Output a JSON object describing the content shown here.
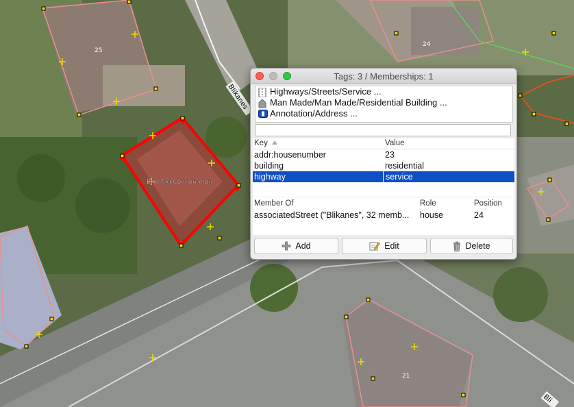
{
  "map": {
    "street_name_left": "Blikanes",
    "street_name_right": "Bli",
    "house_numbers": [
      "25",
      "24",
      "21"
    ],
    "warning_label": "Bad Tag Combination",
    "colors": {
      "selection": "#ff0000",
      "building_outline": "#e89090",
      "node": "#f0e000"
    }
  },
  "dialog": {
    "title": "Tags: 3 / Memberships: 1",
    "presets": [
      {
        "icon": "road-icon",
        "label": "Highways/Streets/Service ..."
      },
      {
        "icon": "house-icon",
        "label": "Man Made/Man Made/Residential Building ..."
      },
      {
        "icon": "address-icon",
        "label": "Annotation/Address ..."
      }
    ],
    "filter_value": "",
    "tags_header": {
      "key": "Key",
      "value": "Value"
    },
    "tags": [
      {
        "key": "addr:housenumber",
        "value": "23"
      },
      {
        "key": "building",
        "value": "residential"
      },
      {
        "key": "highway",
        "value": "service"
      }
    ],
    "members_header": {
      "member_of": "Member Of",
      "role": "Role",
      "position": "Position"
    },
    "members": [
      {
        "member_of": "associatedStreet (\"Blikanes\", 32 memb...",
        "role": "house",
        "position": "24"
      }
    ],
    "buttons": {
      "add": "Add",
      "edit": "Edit",
      "delete": "Delete"
    },
    "selection_color": "#0f4fc4"
  }
}
